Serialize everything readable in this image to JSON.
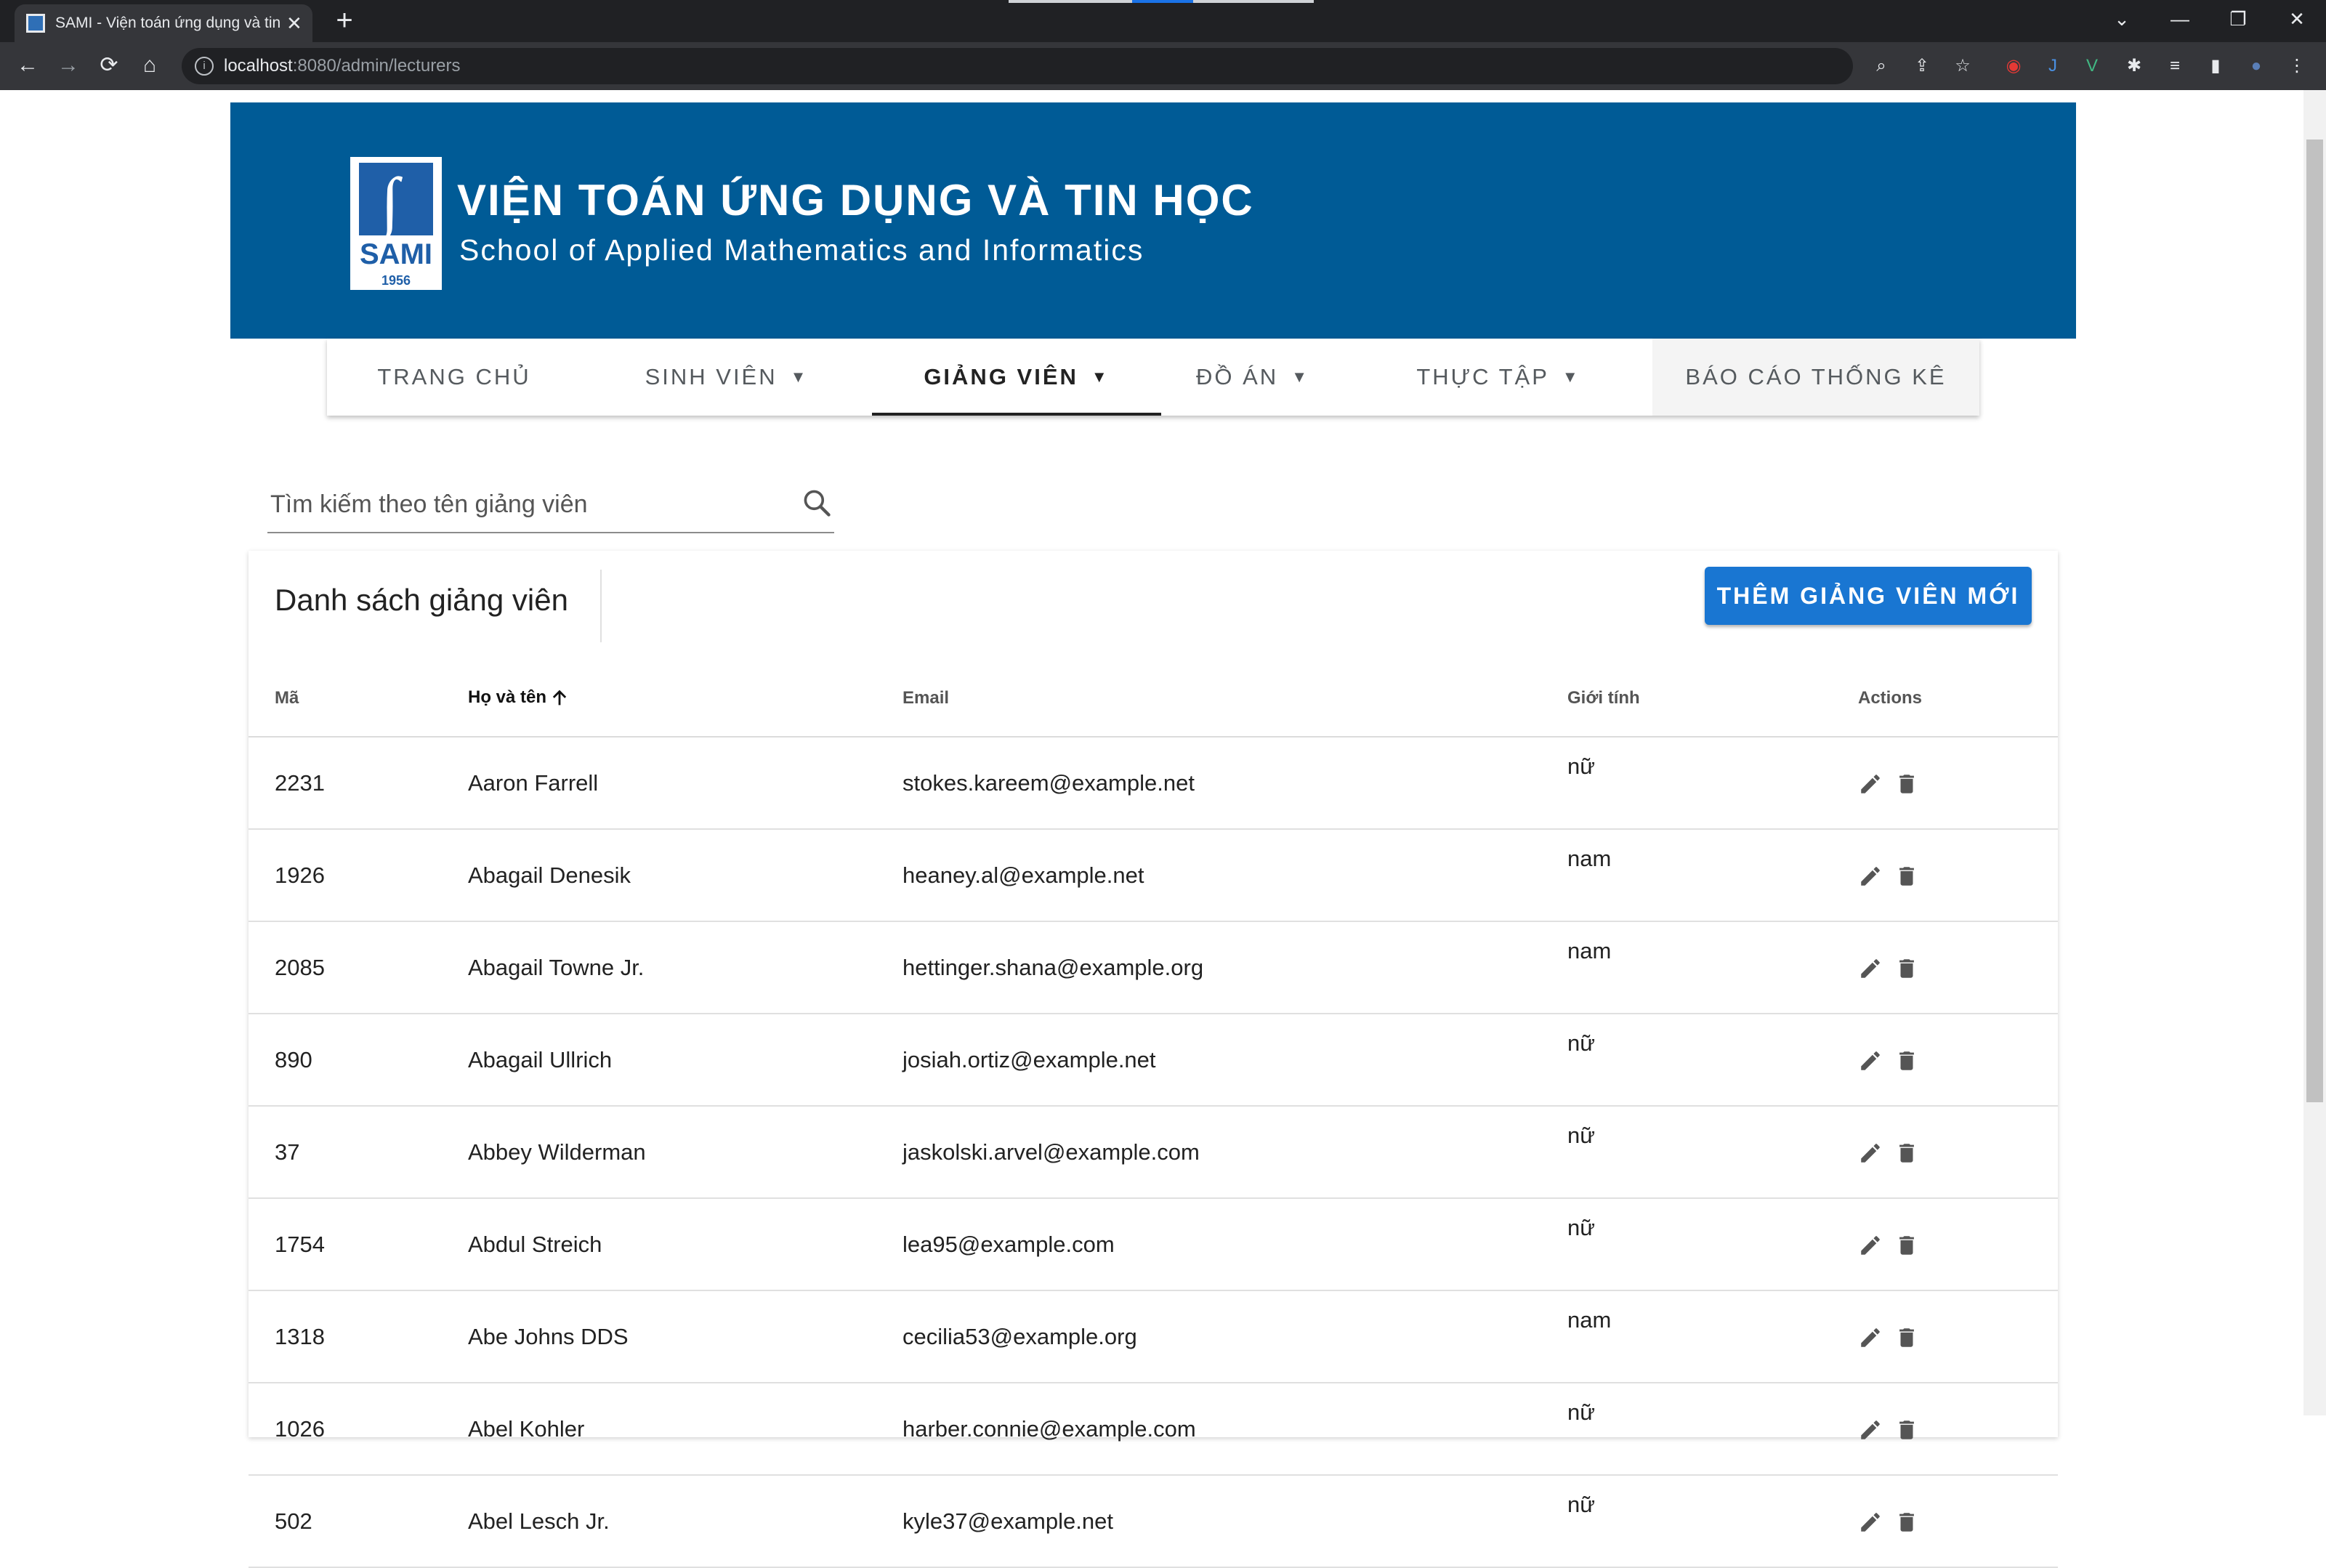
{
  "browser": {
    "tab_title": "SAMI - Viện toán ứng dụng và tin",
    "url_host": "localhost",
    "url_path": ":8080/admin/lecturers"
  },
  "banner": {
    "logo_text": "SAMI",
    "logo_year": "1956",
    "title": "VIỆN TOÁN ỨNG DỤNG VÀ TIN HỌC",
    "subtitle": "School of Applied Mathematics and Informatics"
  },
  "nav": {
    "items": [
      {
        "label": "TRANG CHỦ"
      },
      {
        "label": "SINH VIÊN",
        "caret": "▼"
      },
      {
        "label": "GIẢNG VIÊN",
        "caret": "▼"
      },
      {
        "label": "ĐỒ ÁN",
        "caret": "▼"
      },
      {
        "label": "THỰC TẬP",
        "caret": "▼"
      },
      {
        "label": "BÁO CÁO THỐNG KÊ"
      }
    ]
  },
  "search": {
    "placeholder": "Tìm kiếm theo tên giảng viên"
  },
  "list": {
    "title": "Danh sách giảng viên",
    "add_button": "THÊM GIẢNG VIÊN MỚI",
    "columns": [
      "Mã",
      "Họ và tên",
      "Email",
      "Giới tính",
      "Actions"
    ],
    "rows": [
      {
        "id": "2231",
        "name": "Aaron Farrell",
        "email": "stokes.kareem@example.net",
        "gender": "nữ"
      },
      {
        "id": "1926",
        "name": "Abagail Denesik",
        "email": "heaney.al@example.net",
        "gender": "nam"
      },
      {
        "id": "2085",
        "name": "Abagail Towne Jr.",
        "email": "hettinger.shana@example.org",
        "gender": "nam"
      },
      {
        "id": "890",
        "name": "Abagail Ullrich",
        "email": "josiah.ortiz@example.net",
        "gender": "nữ"
      },
      {
        "id": "37",
        "name": "Abbey Wilderman",
        "email": "jaskolski.arvel@example.com",
        "gender": "nữ"
      },
      {
        "id": "1754",
        "name": "Abdul Streich",
        "email": "lea95@example.com",
        "gender": "nữ"
      },
      {
        "id": "1318",
        "name": "Abe Johns DDS",
        "email": "cecilia53@example.org",
        "gender": "nam"
      },
      {
        "id": "1026",
        "name": "Abel Kohler",
        "email": "harber.connie@example.com",
        "gender": "nữ"
      },
      {
        "id": "502",
        "name": "Abel Lesch Jr.",
        "email": "kyle37@example.net",
        "gender": "nữ"
      }
    ]
  },
  "colors": {
    "banner": "#005b96",
    "primary_button": "#1976d2",
    "browser_chrome": "#202124"
  }
}
